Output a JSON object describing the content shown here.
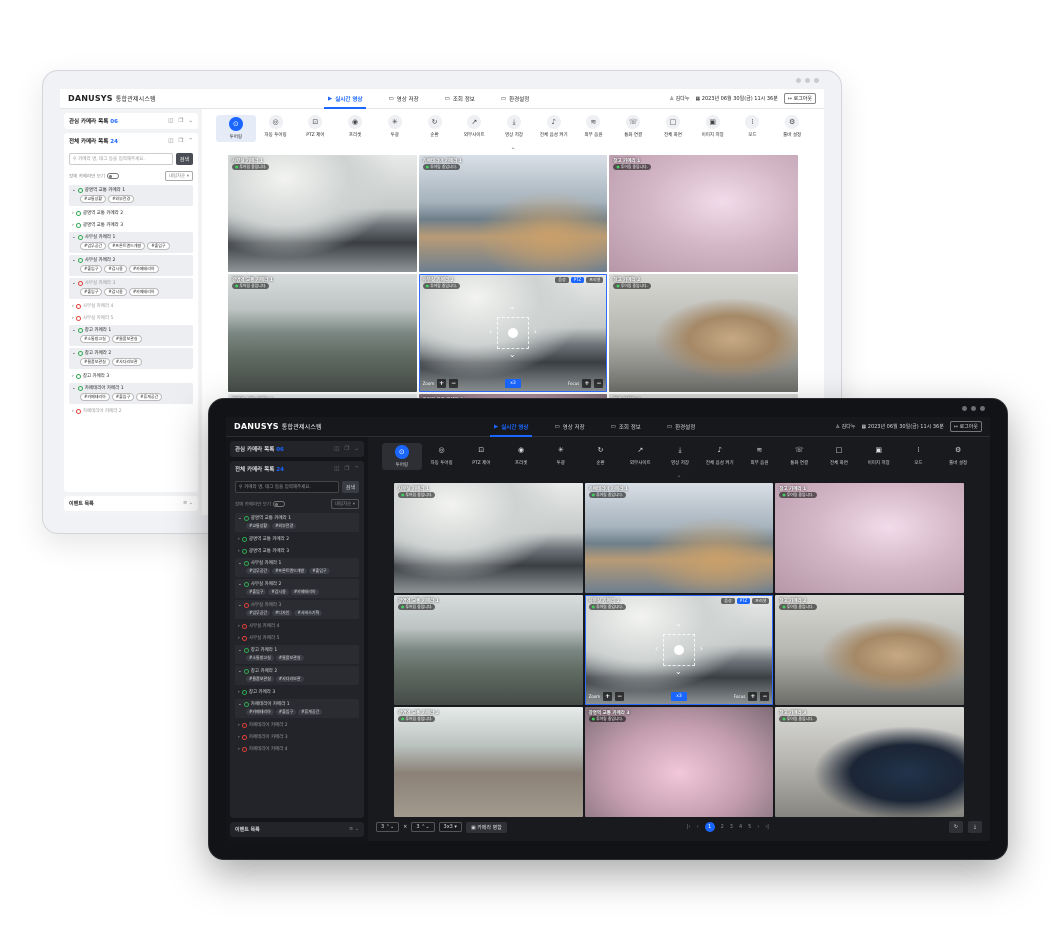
{
  "app": {
    "logo": "DANUSYS",
    "title": "통합관제시스템",
    "nav": [
      {
        "label": "실시간 영상",
        "icon": "video-icon",
        "active": true
      },
      {
        "label": "영상 저장",
        "icon": "storage-icon",
        "active": false
      },
      {
        "label": "조회 정보",
        "icon": "document-icon",
        "active": false
      },
      {
        "label": "환경설정",
        "icon": "gear-icon",
        "active": false
      }
    ],
    "user": "김다누",
    "datetime": "2023년 06월 30일(금) 11시 36분",
    "logout": "로그아웃",
    "accent_color": "#1a66ff"
  },
  "sidebar": {
    "favorites_label": "관심 카메라 목록",
    "favorites_count": "06",
    "all_label": "전체 카메라 목록",
    "all_count": "24",
    "search_placeholder": "카메라 명, 태그 등을 입력해주세요.",
    "search_button": "검색",
    "filter_label": "장애 카메라만 보기",
    "sort_label": "내림차순",
    "events_label": "이벤트 목록"
  },
  "light_cameras": [
    {
      "name": "광명역 교통 카메라 1",
      "status": "online",
      "tags": [
        "#교통상황",
        "#외부전경"
      ]
    },
    {
      "name": "광명역 교통 카메라 2",
      "status": "online",
      "tags": []
    },
    {
      "name": "광명역 교통 카메라 3",
      "status": "online",
      "tags": []
    },
    {
      "name": "사무실 카메라 1",
      "status": "online",
      "tags": [
        "#업무공간",
        "#프론트엔드개발",
        "#출입구"
      ]
    },
    {
      "name": "사무실 카메라 2",
      "status": "online",
      "tags": [
        "#출입구",
        "#감시용",
        "#카페테리아"
      ]
    },
    {
      "name": "사무실 카메라 3",
      "status": "offline",
      "tags": [
        "#출입구",
        "#감시용",
        "#카페테리아"
      ]
    },
    {
      "name": "사무실 카메라 4",
      "status": "offline",
      "tags": []
    },
    {
      "name": "사무실 카메라 5",
      "status": "offline",
      "tags": []
    },
    {
      "name": "창고 카메라 1",
      "status": "online",
      "tags": [
        "#소통창고실",
        "#물품보관실"
      ]
    },
    {
      "name": "창고 카메라 2",
      "status": "online",
      "tags": [
        "#물품보관실",
        "#사다리보관"
      ]
    },
    {
      "name": "창고 카메라 3",
      "status": "online",
      "tags": []
    },
    {
      "name": "카페테리아 카메라 1",
      "status": "online",
      "tags": [
        "#카페테리아",
        "#출입구",
        "#휴게공간"
      ]
    },
    {
      "name": "카페테리아 카메라 2",
      "status": "offline",
      "tags": []
    }
  ],
  "dark_cameras": [
    {
      "name": "광명역 교통 카메라 1",
      "status": "online",
      "tags": [
        "#교통상황",
        "#외부전경"
      ]
    },
    {
      "name": "광명역 교통 카메라 2",
      "status": "online",
      "tags": []
    },
    {
      "name": "광명역 교통 카메라 3",
      "status": "online",
      "tags": []
    },
    {
      "name": "사무실 카메라 1",
      "status": "online",
      "tags": [
        "#업무공간",
        "#프론트엔드개발",
        "#출입구"
      ]
    },
    {
      "name": "사무실 카메라 2",
      "status": "online",
      "tags": [
        "#출입구",
        "#감시용",
        "#카페테리아"
      ]
    },
    {
      "name": "사무실 카메라 3",
      "status": "offline",
      "tags": [
        "#업무공간",
        "#디자인",
        "#서비스기획"
      ]
    },
    {
      "name": "사무실 카메라 4",
      "status": "offline",
      "tags": []
    },
    {
      "name": "사무실 카메라 5",
      "status": "offline",
      "tags": []
    },
    {
      "name": "창고 카메라 1",
      "status": "online",
      "tags": [
        "#소통창고실",
        "#물품보관실"
      ]
    },
    {
      "name": "창고 카메라 2",
      "status": "online",
      "tags": [
        "#물품보관실",
        "#사다리보관"
      ]
    },
    {
      "name": "창고 카메라 3",
      "status": "online",
      "tags": []
    },
    {
      "name": "카페테리아 카메라 1",
      "status": "online",
      "tags": [
        "#카페테리아",
        "#출입구",
        "#휴게공간"
      ]
    },
    {
      "name": "카페테리아 카메라 2",
      "status": "offline",
      "tags": []
    },
    {
      "name": "카페테리아 카메라 3",
      "status": "offline",
      "tags": []
    },
    {
      "name": "카페테리아 카메라 4",
      "status": "offline",
      "tags": []
    }
  ],
  "toolbar": [
    {
      "label": "투어링",
      "icon": "map-pin-icon",
      "glyph": "⊙",
      "active": true
    },
    {
      "label": "자동 투어링",
      "icon": "auto-tour-icon",
      "glyph": "◎"
    },
    {
      "label": "PTZ 제어",
      "icon": "ptz-icon",
      "glyph": "⊡"
    },
    {
      "label": "프리셋",
      "icon": "preset-icon",
      "glyph": "◉"
    },
    {
      "label": "투광",
      "icon": "light-icon",
      "glyph": "✳"
    },
    {
      "label": "순환",
      "icon": "cycle-icon",
      "glyph": "↻"
    },
    {
      "label": "외부사이트",
      "icon": "external-link-icon",
      "glyph": "↗"
    },
    {
      "label": "영상 저장",
      "icon": "download-icon",
      "glyph": "⤓"
    },
    {
      "label": "전체 음성 켜기",
      "icon": "mic-icon",
      "glyph": "♪"
    },
    {
      "label": "외부 음원",
      "icon": "audio-wave-icon",
      "glyph": "≋"
    },
    {
      "label": "통화 연결",
      "icon": "phone-icon",
      "glyph": "☏"
    },
    {
      "label": "전체 화면",
      "icon": "fullscreen-icon",
      "glyph": "□"
    },
    {
      "label": "이미지 저장",
      "icon": "image-save-icon",
      "glyph": "▣"
    },
    {
      "label": "모드",
      "icon": "mode-icon",
      "glyph": "⁞"
    },
    {
      "label": "툴바 설정",
      "icon": "settings-icon",
      "glyph": "⚙"
    }
  ],
  "tiles": [
    {
      "title": "사무실 카메라 1",
      "status": "투어링 중입니다.",
      "scene": "office"
    },
    {
      "title": "카페테리아 카메라 1",
      "status": "투어링 중입니다.",
      "scene": "cafe"
    },
    {
      "title": "창고 카메라 1",
      "status": "투어링 중입니다.",
      "scene": "warehouse"
    },
    {
      "title": "광명역 교통 카메라 1",
      "status": "투어링 중입니다.",
      "scene": "city"
    },
    {
      "title": "사무실 카메라 2",
      "status": "투어링 중입니다.",
      "scene": "office",
      "selected": true
    },
    {
      "title": "창고 카메라 2",
      "status": "투어링 중입니다.",
      "scene": "boxes"
    },
    {
      "title": "광명역 교통 카메라 2",
      "status": "투어링 중입니다.",
      "scene": "road"
    },
    {
      "title": "광명역 교통 카메라 3",
      "status": "투어링 중입니다.",
      "scene": "pink"
    },
    {
      "title": "창고 카메라 3",
      "status": "투어링 중입니다.",
      "scene": "person"
    }
  ],
  "ptz": {
    "audio": "음성",
    "ptz": "PTZ",
    "preset": "프리셋",
    "zoom": "Zoom",
    "focus": "Focus",
    "zoom_level": "x3"
  },
  "bottom": {
    "rows": "3",
    "cols": "3",
    "times": "×",
    "layout": "3x3",
    "combine": "카메라 병합",
    "pages": [
      "1",
      "2",
      "3",
      "4",
      "5"
    ]
  }
}
